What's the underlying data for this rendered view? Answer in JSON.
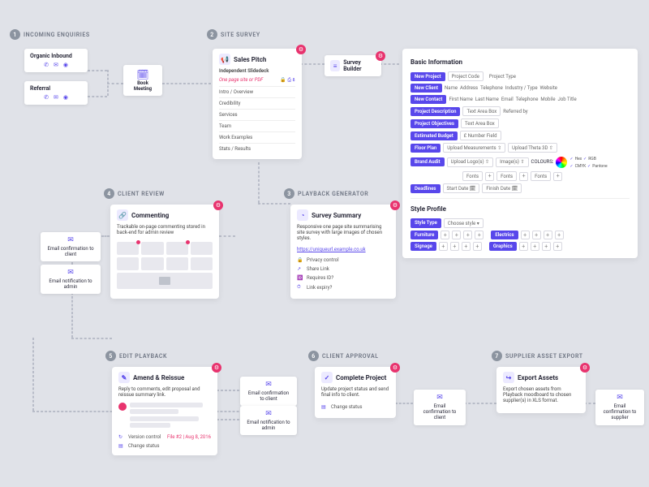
{
  "steps": {
    "s1": "INCOMING ENQUIRIES",
    "s2": "SITE SURVEY",
    "s3": "PLAYBACK GENERATOR",
    "s4": "CLIENT REVIEW",
    "s5": "EDIT PLAYBACK",
    "s6": "CLIENT APPROVAL",
    "s7": "SUPPLIER ASSET EXPORT"
  },
  "enq": {
    "organic": "Organic Inbound",
    "referral": "Referral"
  },
  "book": "Book Meeting",
  "pitch": {
    "title": "Sales Pitch",
    "sub": "Independent Slidedeck",
    "note": "One page site or PDF",
    "items": [
      "Intro / Overview",
      "Credibility",
      "Services",
      "Team",
      "Work Examples",
      "Stats / Results"
    ]
  },
  "survey_builder": "Survey Builder",
  "basic": {
    "title": "Basic Information",
    "new_project": "New Project",
    "project_code": "Project Code",
    "project_type": "Project Type",
    "new_client": "New Client",
    "name": "Name",
    "address": "Address",
    "tel": "Telephone",
    "industry": "Industry / Type",
    "website": "Website",
    "new_contact": "New Contact",
    "fname": "First Name",
    "lname": "Last Name",
    "email": "Email",
    "tel2": "Telephone",
    "mobile": "Mobile",
    "jobtitle": "Job Title",
    "desc": "Project Description",
    "textarea": "Text Area Box",
    "obj": "Project Objectives",
    "budget": "Estimated Budget",
    "budget_field": "£ Number Field",
    "floor": "Floor Plan",
    "upload_meas": "Upload Measurements",
    "upload_theta": "Upload Theta 3D",
    "brand": "Brand Audit",
    "upload_logo": "Upload Logo(s)",
    "images": "Image(s)",
    "colours": "COLOURS:",
    "hex": "Hex",
    "rgb": "RGB",
    "cmyk": "CMYK",
    "pantone": "Pantone",
    "fonts": "Fonts",
    "deadlines": "Deadlines",
    "start": "Start Date",
    "finish": "Finish Date"
  },
  "style": {
    "title": "Style Profile",
    "style_type": "Style Type",
    "choose": "Choose style",
    "furniture": "Furniture",
    "electrics": "Electrics",
    "signage": "Signage",
    "graphics": "Graphics"
  },
  "summary": {
    "title": "Survey Summary",
    "desc": "Responsive one page site summarising site survey with large images of chosen styles.",
    "url": "https://uniqueurl.example.co.uk",
    "f1": "Privacy control",
    "f2": "Share Link",
    "f3": "Requires ID?",
    "f4": "Link expiry?"
  },
  "comment": {
    "title": "Commenting",
    "desc": "Trackable on-page commenting stored in back-end for admin review"
  },
  "emails": {
    "client": "Email confirmation to client",
    "admin": "Email notification to admin",
    "supplier": "Email confirmation to supplier"
  },
  "amend": {
    "title": "Amend & Reissue",
    "desc": "Reply to comments, edit proposal and reissue summary link.",
    "version": "Version control",
    "file": "File #2 | Aug 8, 2016",
    "status": "Change status"
  },
  "complete": {
    "title": "Complete Project",
    "desc": "Update project status and send final info to client.",
    "status": "Change status"
  },
  "export": {
    "title": "Export Assets",
    "desc": "Export chosen assets from Playback moodboard to chosen supplier(s) in XLS format."
  }
}
